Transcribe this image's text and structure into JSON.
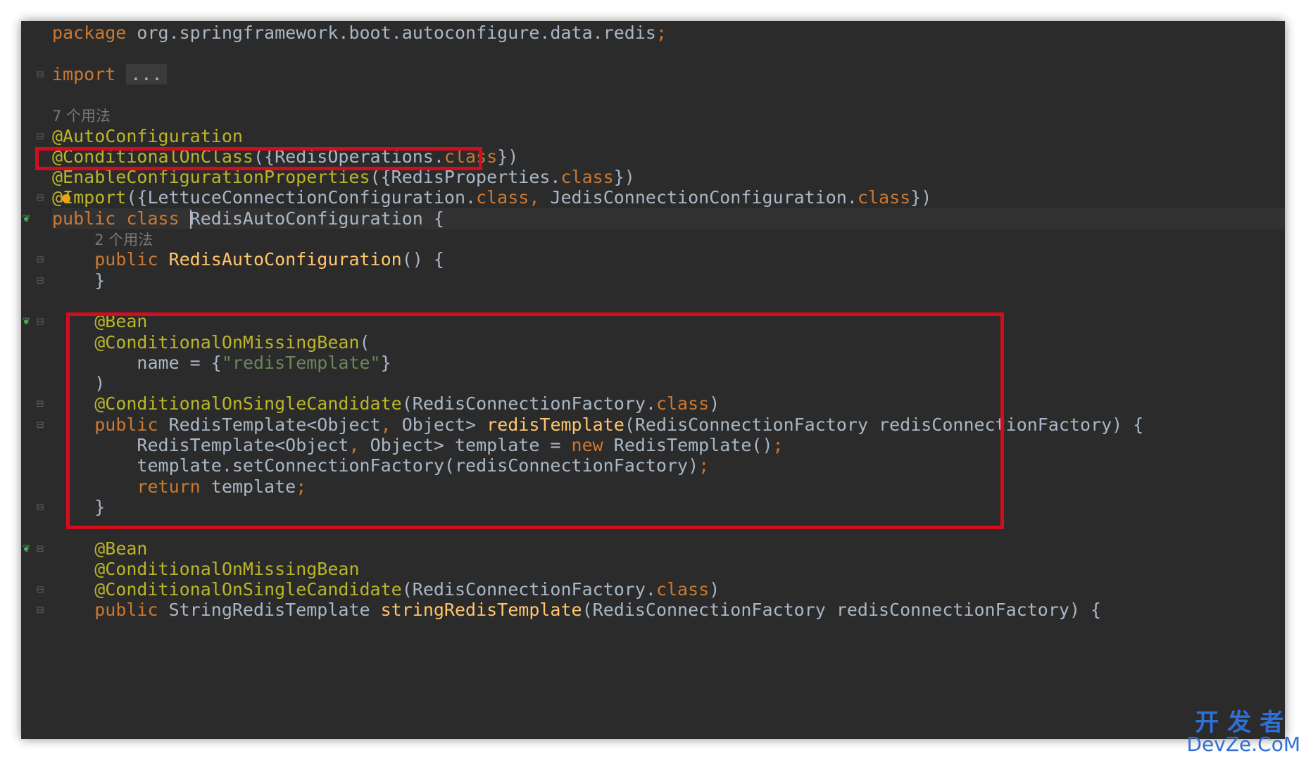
{
  "lines": [
    {
      "indent": "",
      "tokens": [
        {
          "t": "package ",
          "c": "kw"
        },
        {
          "t": "org.springframework.boot.autoconfigure.data.redis"
        },
        {
          "t": ";",
          "c": "kw"
        }
      ]
    },
    {
      "indent": "",
      "tokens": []
    },
    {
      "indent": "",
      "tokens": [
        {
          "t": "import ",
          "c": "kw"
        },
        {
          "t": "...",
          "c": "fold-box"
        }
      ]
    },
    {
      "indent": "",
      "tokens": []
    },
    {
      "indent": "",
      "hint": "7 个用法"
    },
    {
      "indent": "",
      "tokens": [
        {
          "t": "@AutoConfiguration",
          "c": "ann"
        }
      ]
    },
    {
      "indent": "",
      "tokens": [
        {
          "t": "@ConditionalOnClass",
          "c": "ann"
        },
        {
          "t": "({RedisOperations."
        },
        {
          "t": "class",
          "c": "kw"
        },
        {
          "t": "})"
        }
      ]
    },
    {
      "indent": "",
      "tokens": [
        {
          "t": "@EnableConfigurationProperties",
          "c": "ann"
        },
        {
          "t": "({RedisProperties."
        },
        {
          "t": "class",
          "c": "kw"
        },
        {
          "t": "})"
        }
      ]
    },
    {
      "indent": "",
      "tokens": [
        {
          "t": "@Import",
          "c": "ann"
        },
        {
          "t": "({LettuceConnectionConfiguration."
        },
        {
          "t": "class",
          "c": "kw"
        },
        {
          "t": ", ",
          "c": "kw"
        },
        {
          "t": "JedisConnectionConfiguration."
        },
        {
          "t": "class",
          "c": "kw"
        },
        {
          "t": "})"
        }
      ]
    },
    {
      "indent": "",
      "current": true,
      "tokens": [
        {
          "t": "public class ",
          "c": "kw"
        },
        {
          "caret": true
        },
        {
          "t": "RedisAutoConfiguration"
        },
        {
          "t": " {"
        }
      ]
    },
    {
      "indent": "    ",
      "hint": "2 个用法"
    },
    {
      "indent": "    ",
      "tokens": [
        {
          "t": "public ",
          "c": "kw"
        },
        {
          "t": "RedisAutoConfiguration",
          "c": "fn"
        },
        {
          "t": "() {"
        }
      ]
    },
    {
      "indent": "    ",
      "tokens": [
        {
          "t": "}"
        }
      ]
    },
    {
      "indent": "",
      "tokens": []
    },
    {
      "indent": "    ",
      "tokens": [
        {
          "t": "@Bean",
          "c": "ann"
        }
      ]
    },
    {
      "indent": "    ",
      "tokens": [
        {
          "t": "@ConditionalOnMissingBean",
          "c": "ann"
        },
        {
          "t": "("
        }
      ]
    },
    {
      "indent": "        ",
      "tokens": [
        {
          "t": "name = {"
        },
        {
          "t": "\"redisTemplate\"",
          "c": "str"
        },
        {
          "t": "}"
        }
      ]
    },
    {
      "indent": "    ",
      "tokens": [
        {
          "t": ")"
        }
      ]
    },
    {
      "indent": "    ",
      "tokens": [
        {
          "t": "@ConditionalOnSingleCandidate",
          "c": "ann"
        },
        {
          "t": "(RedisConnectionFactory."
        },
        {
          "t": "class",
          "c": "kw"
        },
        {
          "t": ")"
        }
      ]
    },
    {
      "indent": "    ",
      "tokens": [
        {
          "t": "public ",
          "c": "kw"
        },
        {
          "t": "RedisTemplate<Object"
        },
        {
          "t": ", ",
          "c": "kw"
        },
        {
          "t": "Object> "
        },
        {
          "t": "redisTemplate",
          "c": "fn"
        },
        {
          "t": "(RedisConnectionFactory redisConnectionFactory) {"
        }
      ]
    },
    {
      "indent": "        ",
      "tokens": [
        {
          "t": "RedisTemplate<Object"
        },
        {
          "t": ", ",
          "c": "kw"
        },
        {
          "t": "Object> template = "
        },
        {
          "t": "new ",
          "c": "kw"
        },
        {
          "t": "RedisTemplate()"
        },
        {
          "t": ";",
          "c": "kw"
        }
      ]
    },
    {
      "indent": "        ",
      "tokens": [
        {
          "t": "template.setConnectionFactory(redisConnectionFactory)"
        },
        {
          "t": ";",
          "c": "kw"
        }
      ]
    },
    {
      "indent": "        ",
      "tokens": [
        {
          "t": "return ",
          "c": "kw"
        },
        {
          "t": "template"
        },
        {
          "t": ";",
          "c": "kw"
        }
      ]
    },
    {
      "indent": "    ",
      "tokens": [
        {
          "t": "}"
        }
      ]
    },
    {
      "indent": "",
      "tokens": []
    },
    {
      "indent": "    ",
      "tokens": [
        {
          "t": "@Bean",
          "c": "ann"
        }
      ]
    },
    {
      "indent": "    ",
      "tokens": [
        {
          "t": "@ConditionalOnMissingBean",
          "c": "ann"
        }
      ]
    },
    {
      "indent": "    ",
      "tokens": [
        {
          "t": "@ConditionalOnSingleCandidate",
          "c": "ann"
        },
        {
          "t": "(RedisConnectionFactory."
        },
        {
          "t": "class",
          "c": "kw"
        },
        {
          "t": ")"
        }
      ]
    },
    {
      "indent": "    ",
      "tokens": [
        {
          "t": "public ",
          "c": "kw"
        },
        {
          "t": "StringRedisTemplate "
        },
        {
          "t": "stringRedisTemplate",
          "c": "fn"
        },
        {
          "t": "(RedisConnectionFactory redisConnectionFactory) {"
        }
      ]
    }
  ],
  "gutter": {
    "fold_icon": "fold-icon",
    "run_icon": "bean-gutter-icon",
    "intention_icon": "intention-bulb-icon",
    "fold_lines": [
      2,
      5,
      8,
      11,
      12,
      14,
      18,
      19,
      23,
      25,
      27,
      28
    ],
    "run_lines": [
      9,
      14,
      25
    ]
  },
  "highlights": [
    "annotation-conditional-on-class",
    "redis-template-bean-method"
  ],
  "colors": {
    "highlight": "#d30c1e",
    "background": "#2b2b2b"
  },
  "watermark": {
    "cn": "开发者",
    "en": "DevZe.CoM"
  }
}
